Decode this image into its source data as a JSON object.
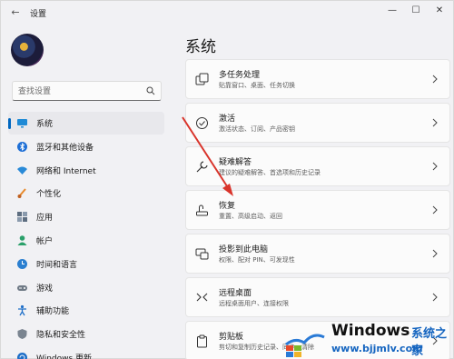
{
  "app": {
    "title": "设置",
    "back_icon": "back-arrow-icon",
    "controls": {
      "minimize": "—",
      "maximize": "☐",
      "close": "✕"
    }
  },
  "search": {
    "placeholder": "查找设置"
  },
  "sidebar": {
    "items": [
      {
        "label": "系统",
        "icon": "monitor-icon",
        "active": true
      },
      {
        "label": "蓝牙和其他设备",
        "icon": "bluetooth-icon"
      },
      {
        "label": "网络和 Internet",
        "icon": "wifi-icon"
      },
      {
        "label": "个性化",
        "icon": "brush-icon"
      },
      {
        "label": "应用",
        "icon": "apps-icon"
      },
      {
        "label": "帐户",
        "icon": "person-icon"
      },
      {
        "label": "时间和语言",
        "icon": "globe-clock-icon"
      },
      {
        "label": "游戏",
        "icon": "gamepad-icon"
      },
      {
        "label": "辅助功能",
        "icon": "accessibility-icon"
      },
      {
        "label": "隐私和安全性",
        "icon": "shield-icon"
      },
      {
        "label": "Windows 更新",
        "icon": "update-icon"
      }
    ]
  },
  "main": {
    "title": "系统",
    "cards": [
      {
        "title": "多任务处理",
        "subtitle": "贴靠窗口、桌面、任务切换",
        "icon": "multitask-icon"
      },
      {
        "title": "激活",
        "subtitle": "激活状态、订阅、产品密钥",
        "icon": "activation-check-icon"
      },
      {
        "title": "疑难解答",
        "subtitle": "建议的疑难解答、首选项和历史记录",
        "icon": "wrench-icon"
      },
      {
        "title": "恢复",
        "subtitle": "重置、高级启动、返回",
        "icon": "recovery-icon"
      },
      {
        "title": "投影到此电脑",
        "subtitle": "权限、配对 PIN、可发现性",
        "icon": "project-icon"
      },
      {
        "title": "远程桌面",
        "subtitle": "远程桌面用户、连接权限",
        "icon": "remote-icon"
      },
      {
        "title": "剪贴板",
        "subtitle": "剪切和复制历史记录、同步、清除",
        "icon": "clipboard-icon"
      }
    ]
  },
  "watermark": {
    "brand": "Windows",
    "suffix": "系统之家",
    "url": "www.bjjmlv.com"
  },
  "colors": {
    "accent": "#0067c0",
    "arrow": "#d9342b"
  }
}
